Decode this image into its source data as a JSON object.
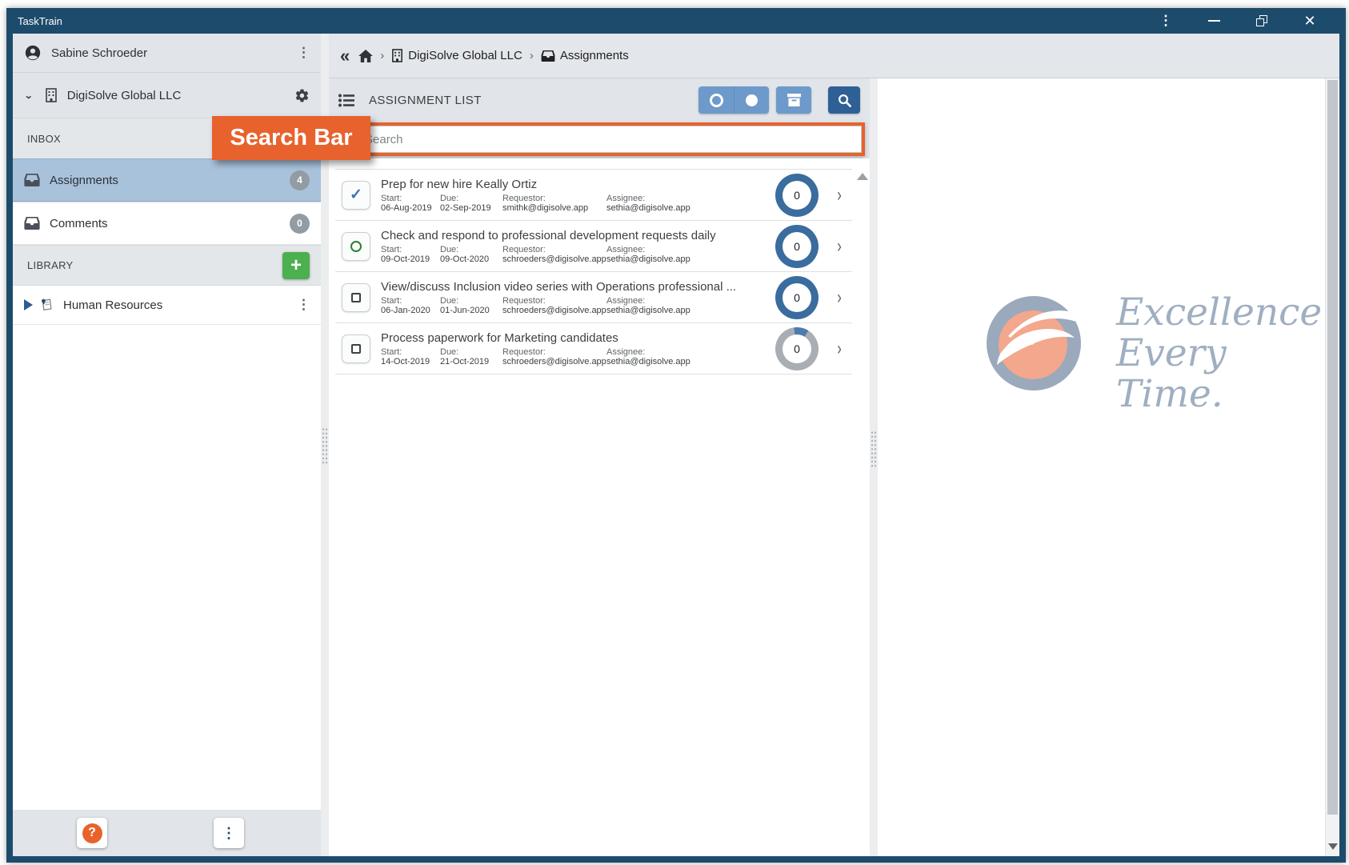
{
  "app": {
    "title": "TaskTrain"
  },
  "sidebar": {
    "user_name": "Sabine Schroeder",
    "org_name": "DigiSolve Global LLC",
    "inbox_header": "INBOX",
    "library_header": "LIBRARY",
    "assignments": {
      "label": "Assignments",
      "count": "4"
    },
    "comments": {
      "label": "Comments",
      "count": "0"
    },
    "library_item": "Human Resources",
    "help_label": "?"
  },
  "breadcrumb": {
    "org": "DigiSolve Global LLC",
    "current": "Assignments"
  },
  "assignment_list": {
    "title": "ASSIGNMENT LIST",
    "search_placeholder": "Search",
    "meta_labels": {
      "start": "Start:",
      "due": "Due:",
      "requestor": "Requestor:",
      "assignee": "Assignee:"
    },
    "items": [
      {
        "title": "Prep for new hire Keally Ortiz",
        "status": "completed",
        "start": "06-Aug-2019",
        "due": "02-Sep-2019",
        "requestor": "smithk@digisolve.app",
        "assignee": "sethia@digisolve.app",
        "progress": "0"
      },
      {
        "title": "Check and respond to professional development requests daily",
        "status": "in_progress",
        "start": "09-Oct-2019",
        "due": "09-Oct-2020",
        "requestor": "schroeders@digisolve.app",
        "assignee": "sethia@digisolve.app",
        "progress": "0"
      },
      {
        "title": "View/discuss Inclusion video series with Operations professional ...",
        "status": "not_started",
        "start": "06-Jan-2020",
        "due": "01-Jun-2020",
        "requestor": "schroeders@digisolve.app",
        "assignee": "sethia@digisolve.app",
        "progress": "0"
      },
      {
        "title": "Process paperwork for Marketing candidates",
        "status": "not_started",
        "start": "14-Oct-2019",
        "due": "21-Oct-2019",
        "requestor": "schroeders@digisolve.app",
        "assignee": "sethia@digisolve.app",
        "progress": "0"
      }
    ]
  },
  "annotation": {
    "label": "Search Bar"
  },
  "brand": {
    "tagline_lines": [
      "Excellence.",
      "Every",
      "Time."
    ]
  },
  "colors": {
    "navy": "#1D4B6B",
    "accent_orange": "#E8622D",
    "selected_blue": "#A9C2DC",
    "button_blue": "#6D9ACA",
    "search_button_blue": "#2E6096",
    "ring_blue": "#3A6C9E",
    "ring_gray": "#A8AEB4",
    "green": "#4CAF50"
  }
}
